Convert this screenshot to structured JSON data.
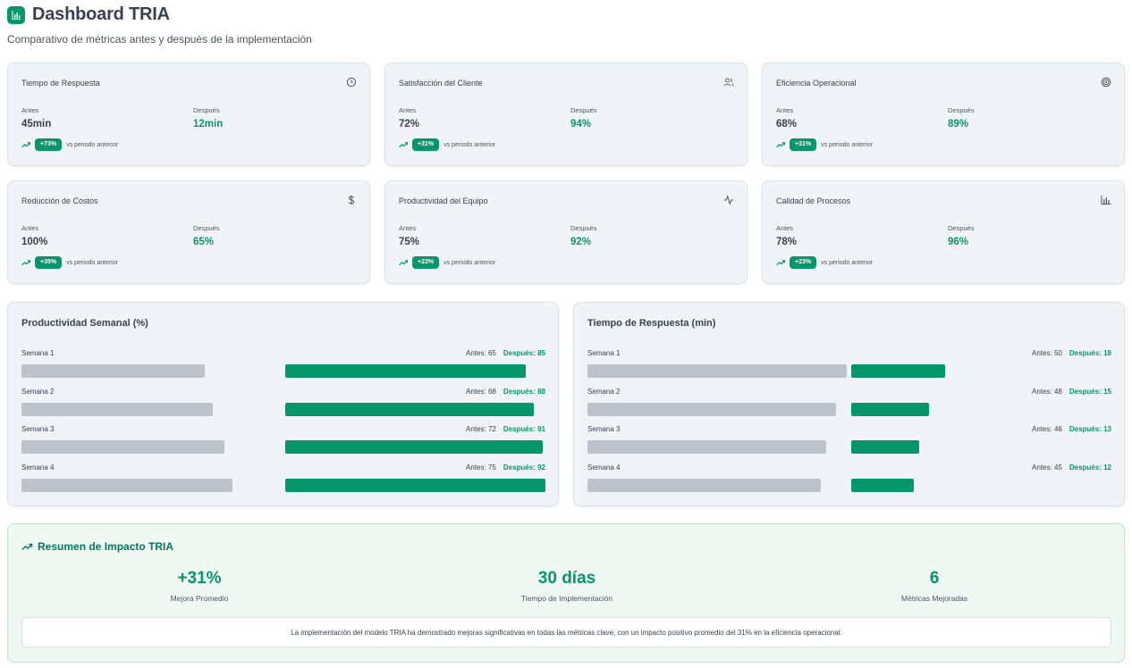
{
  "header": {
    "title": "Dashboard TRIA",
    "subtitle": "Comparativo de métricas antes y después de la implementación",
    "logo_icon": "bar-chart-icon"
  },
  "colors": {
    "accent": "#059669",
    "before_bar": "#bcc3cb",
    "card_bg": "#f0f4f8",
    "summary_bg": "#eff8f3"
  },
  "metrics": [
    {
      "name": "Tiempo de Respuesta",
      "icon": "clock-icon",
      "before_label": "Antes",
      "before": "45min",
      "after_label": "Después",
      "after": "12min",
      "badge": "+73%",
      "note": "vs periodo anterior"
    },
    {
      "name": "Satisfacción del Cliente",
      "icon": "users-icon",
      "before_label": "Antes",
      "before": "72%",
      "after_label": "Después",
      "after": "94%",
      "badge": "+31%",
      "note": "vs periodo anterior"
    },
    {
      "name": "Eficiencia Operacional",
      "icon": "target-icon",
      "before_label": "Antes",
      "before": "68%",
      "after_label": "Después",
      "after": "89%",
      "badge": "+31%",
      "note": "vs periodo anterior"
    },
    {
      "name": "Reducción de Costos",
      "icon": "dollar-icon",
      "before_label": "Antes",
      "before": "100%",
      "after_label": "Después",
      "after": "65%",
      "badge": "+35%",
      "note": "vs periodo anterior"
    },
    {
      "name": "Productividad del Equipo",
      "icon": "activity-icon",
      "before_label": "Antes",
      "before": "75%",
      "after_label": "Después",
      "after": "92%",
      "badge": "+23%",
      "note": "vs periodo anterior"
    },
    {
      "name": "Calidad de Procesos",
      "icon": "bar-chart-icon",
      "before_label": "Antes",
      "before": "78%",
      "after_label": "Después",
      "after": "96%",
      "badge": "+23%",
      "note": "vs periodo anterior"
    }
  ],
  "chart_data": [
    {
      "type": "bar",
      "title": "Productividad Semanal (%)",
      "categories": [
        "Semana 1",
        "Semana 2",
        "Semana 3",
        "Semana 4"
      ],
      "series": [
        {
          "name": "Antes",
          "values": [
            65,
            68,
            72,
            75
          ]
        },
        {
          "name": "Después",
          "values": [
            85,
            88,
            91,
            92
          ]
        }
      ]
    },
    {
      "type": "bar",
      "title": "Tiempo de Respuesta (min)",
      "categories": [
        "Semana 1",
        "Semana 2",
        "Semana 3",
        "Semana 4"
      ],
      "series": [
        {
          "name": "Antes",
          "values": [
            50,
            48,
            46,
            45
          ]
        },
        {
          "name": "Después",
          "values": [
            18,
            15,
            13,
            12
          ]
        }
      ]
    }
  ],
  "summary": {
    "title": "Resumen de Impacto TRIA",
    "stats": [
      {
        "value": "+31%",
        "label": "Mejora Promedio"
      },
      {
        "value": "30 días",
        "label": "Tiempo de Implementación"
      },
      {
        "value": "6",
        "label": "Métricas Mejoradas"
      }
    ],
    "note": "La implementación del modelo TRIA ha demostrado mejoras significativas en todas las métricas clave, con un impacto positivo promedio del 31% en la eficiencia operacional."
  }
}
